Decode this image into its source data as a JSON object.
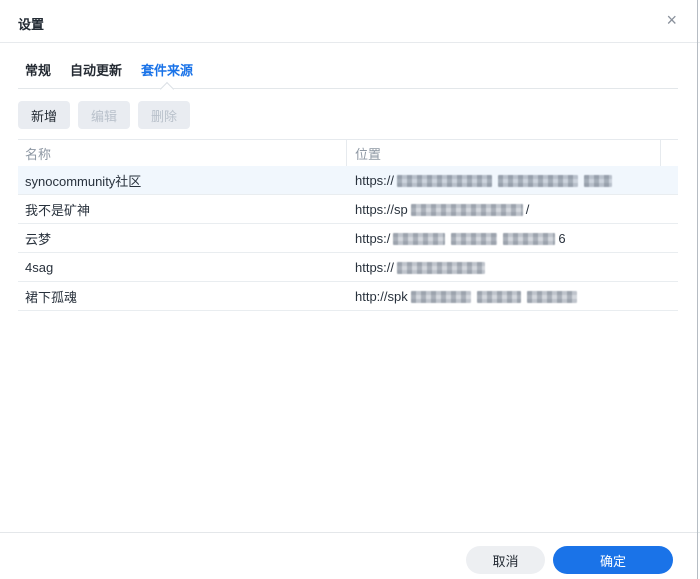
{
  "dialog": {
    "title": "设置",
    "close_icon": "×"
  },
  "tabs": [
    {
      "label": "常规",
      "active": false
    },
    {
      "label": "自动更新",
      "active": false
    },
    {
      "label": "套件来源",
      "active": true
    }
  ],
  "toolbar": {
    "add": "新增",
    "edit": "编辑",
    "delete": "删除"
  },
  "table": {
    "columns": [
      "名称",
      "位置"
    ],
    "rows": [
      {
        "name": "synocommunity社区",
        "url_prefix": "https://",
        "redact": [
          95,
          80,
          28
        ],
        "url_suffix": "",
        "selected": true
      },
      {
        "name": "我不是矿神",
        "url_prefix": "https://sp",
        "redact": [
          112
        ],
        "url_suffix": "/",
        "selected": false
      },
      {
        "name": "云梦",
        "url_prefix": "https:/",
        "redact": [
          52,
          46,
          52
        ],
        "url_suffix": "6",
        "selected": false
      },
      {
        "name": "4sag",
        "url_prefix": "https://",
        "redact": [
          88
        ],
        "url_suffix": "",
        "selected": false
      },
      {
        "name": "裙下孤魂",
        "url_prefix": "http://spk",
        "redact": [
          60,
          44,
          50
        ],
        "url_suffix": "",
        "selected": false
      }
    ]
  },
  "footer": {
    "cancel": "取消",
    "ok": "确定"
  },
  "colors": {
    "accent_blue": "#1a73e8",
    "selected_row_bg": "#f1f7fd",
    "disabled_text": "#b9c1cb"
  }
}
